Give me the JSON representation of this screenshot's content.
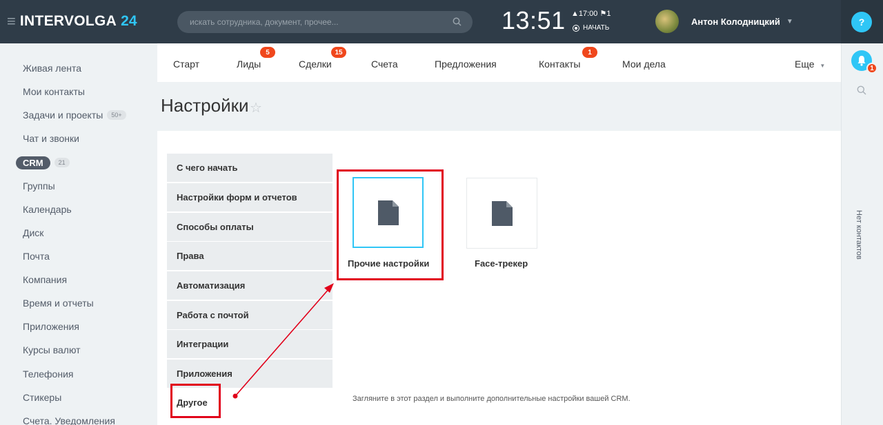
{
  "header": {
    "logo_main": "INTERVOLGA",
    "logo_num": "24",
    "search_placeholder": "искать сотрудника, документ, прочее...",
    "clock": "13:51",
    "alarm": "▲17:00   ⚑1",
    "start": "НАЧАТЬ",
    "user_name": "Антон Колодницкий",
    "help": "?"
  },
  "left_menu": {
    "items": [
      "Живая лента",
      "Мои контакты",
      "Задачи и проекты",
      "Чат и звонки",
      "CRM",
      "Группы",
      "Календарь",
      "Диск",
      "Почта",
      "Компания",
      "Время и отчеты",
      "Приложения",
      "Курсы валют",
      "Телефония",
      "Стикеры",
      "Счета. Уведомления"
    ],
    "tasks_counter": "50+",
    "crm_counter": "21"
  },
  "tabs": {
    "items": [
      {
        "label": "Старт",
        "badge": ""
      },
      {
        "label": "Лиды",
        "badge": "5"
      },
      {
        "label": "Сделки",
        "badge": "15"
      },
      {
        "label": "Счета",
        "badge": ""
      },
      {
        "label": "Предложения",
        "badge": ""
      },
      {
        "label": "Контакты",
        "badge": "1"
      },
      {
        "label": "Мои дела",
        "badge": ""
      }
    ],
    "more": "Еще"
  },
  "page": {
    "title": "Настройки",
    "star": "☆"
  },
  "settings_menu": {
    "items": [
      "С чего начать",
      "Настройки форм и отчетов",
      "Способы оплаты",
      "Права",
      "Автоматизация",
      "Работа с почтой",
      "Интеграции",
      "Приложения",
      "Другое"
    ],
    "active": "Другое"
  },
  "cards": [
    {
      "label": "Прочие настройки",
      "selected": true
    },
    {
      "label": "Face-трекер",
      "selected": false
    }
  ],
  "description": "Загляните в этот раздел и выполните дополнительные настройки вашей CRM.",
  "right_panel": {
    "notification_count": "1",
    "no_contacts": "Нет контактов"
  },
  "colors": {
    "header_bg": "#2f3c48",
    "accent": "#2fc6f6",
    "badge": "#f0471c",
    "highlight": "#e1001a"
  }
}
